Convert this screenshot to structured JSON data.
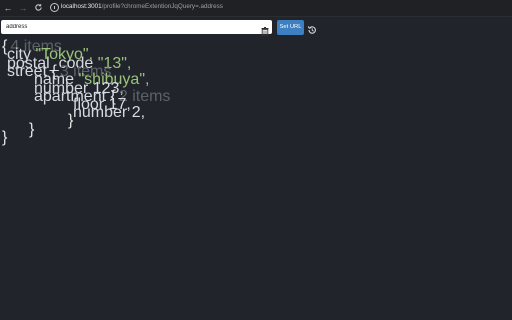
{
  "browser": {
    "url_host": "localhost:3001",
    "url_path": "/profile?chromeExtentionJqQuery=.address",
    "back_glyph": "←",
    "forward_glyph": "→",
    "reload_glyph": "C"
  },
  "toolbar": {
    "query_value": "address",
    "set_url_label": "Set URL"
  },
  "json": {
    "root_open": "{",
    "root_meta": "4 items",
    "root_close": "}",
    "city_key": "city",
    "city_value": "\"Tokyo\",",
    "postal_key": "postal_code",
    "postal_value": "\"13\",",
    "street_key": "street",
    "street_open": "{",
    "street_meta": "3 items",
    "street_close": "}",
    "name_key": "name",
    "name_value": "\"shibuya\",",
    "number_key": "number",
    "number_value": "123,",
    "apartment_key": "apartment",
    "apartment_open": "{",
    "apartment_meta": "2 items",
    "apartment_close": "}",
    "floor_key": "floor",
    "floor_value": "17,",
    "apt_number_key": "number",
    "apt_number_value": "2,"
  },
  "colors": {
    "background": "#21242b",
    "accent": "#3d7fc1",
    "string": "#98c379"
  }
}
